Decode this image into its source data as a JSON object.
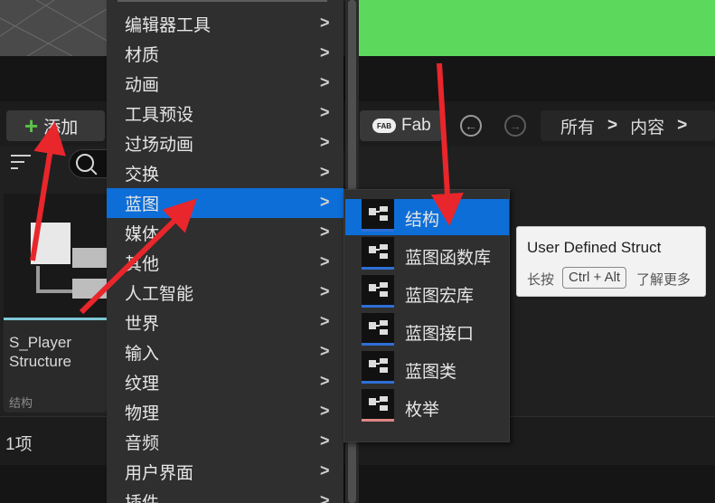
{
  "toolbar": {
    "add_label": "添加",
    "add_icon": "plus-icon",
    "fab_label": "Fab",
    "fab_logo_text": "FAB",
    "back_icon": "arrow-left-circle-icon",
    "forward_icon": "arrow-right-circle-icon"
  },
  "breadcrumb": {
    "items": [
      "所有",
      "内容"
    ],
    "separator": ">"
  },
  "asset": {
    "name": "S_Player\nStructure",
    "type": "结构"
  },
  "status": {
    "item_count": "1项"
  },
  "menu": {
    "items": [
      {
        "label": "编辑器工具"
      },
      {
        "label": "材质"
      },
      {
        "label": "动画"
      },
      {
        "label": "工具预设"
      },
      {
        "label": "过场动画"
      },
      {
        "label": "交换"
      },
      {
        "label": "蓝图"
      },
      {
        "label": "媒体"
      },
      {
        "label": "其他"
      },
      {
        "label": "人工智能"
      },
      {
        "label": "世界"
      },
      {
        "label": "输入"
      },
      {
        "label": "纹理"
      },
      {
        "label": "物理"
      },
      {
        "label": "音频"
      },
      {
        "label": "用户界面"
      },
      {
        "label": "插件"
      }
    ],
    "active_index": 6,
    "arrow": ">"
  },
  "submenu": {
    "items": [
      {
        "label": "结构",
        "icon": "struct-icon"
      },
      {
        "label": "蓝图函数库",
        "icon": "blueprint-node-icon"
      },
      {
        "label": "蓝图宏库",
        "icon": "blueprint-node-icon"
      },
      {
        "label": "蓝图接口",
        "icon": "blueprint-node-icon"
      },
      {
        "label": "蓝图类",
        "icon": "blueprint-node-icon"
      },
      {
        "label": "枚举",
        "icon": "enum-list-icon"
      }
    ],
    "active_index": 0
  },
  "tooltip": {
    "title": "User Defined Struct",
    "press": "长按",
    "keys": "Ctrl + Alt",
    "more": "了解更多"
  },
  "colors": {
    "accent": "#0d6ed8",
    "annotation_arrow": "#e8262b",
    "viewport_green": "#5cd85c"
  }
}
